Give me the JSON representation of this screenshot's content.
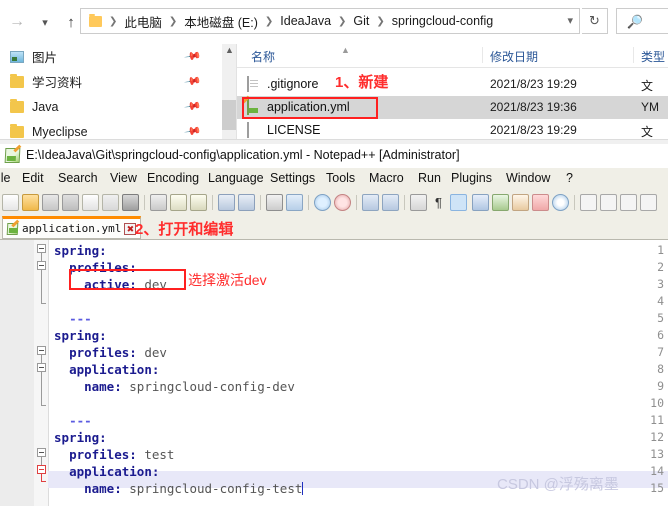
{
  "explorer": {
    "nav": {
      "forward_icon": "arrow-right-icon",
      "history_icon": "chevron-down-icon",
      "up_icon": "arrow-up-icon",
      "refresh_icon": "refresh-icon",
      "search_icon": "search-icon",
      "path_dropdown_icon": "chevron-down-icon"
    },
    "breadcrumbs": [
      "此电脑",
      "本地磁盘 (E:)",
      "IdeaJava",
      "Git",
      "springcloud-config"
    ],
    "quick_access": [
      {
        "label": "图片",
        "icon": "picture-icon",
        "pin": "pin-icon"
      },
      {
        "label": "学习资料",
        "icon": "folder-icon",
        "pin": "pin-icon"
      },
      {
        "label": "Java",
        "icon": "folder-icon",
        "pin": "pin-icon"
      },
      {
        "label": "Myeclipse",
        "icon": "folder-icon",
        "pin": "pin-icon"
      }
    ],
    "columns": {
      "name": "名称",
      "date": "修改日期",
      "type": "类型",
      "sort_icon": "sort-asc-icon"
    },
    "files": [
      {
        "name": ".gitignore",
        "date": "2021/8/23 19:29",
        "type": "文",
        "icon": "text-file-icon",
        "selected": false
      },
      {
        "name": "application.yml",
        "date": "2021/8/23 19:36",
        "type": "YM",
        "icon": "notepadpp-file-icon",
        "selected": true
      },
      {
        "name": "LICENSE",
        "date": "2021/8/23 19:29",
        "type": "文",
        "icon": "text-file-icon",
        "selected": false
      }
    ]
  },
  "annotations": {
    "step1": "1、新建",
    "step2": "2、打开和编辑",
    "step3": "选择激活dev"
  },
  "notepad": {
    "title": "E:\\IdeaJava\\Git\\springcloud-config\\application.yml - Notepad++ [Administrator]",
    "title_icon": "notepadpp-icon",
    "menus": [
      "ile",
      "Edit",
      "Search",
      "View",
      "Encoding",
      "Language",
      "Settings",
      "Tools",
      "Macro",
      "Run",
      "Plugins",
      "Window",
      "?"
    ],
    "toolbar_icons": [
      "new-icon",
      "open-icon",
      "save-icon",
      "save-all-icon",
      "close-icon",
      "close-all-icon",
      "print-icon",
      "cut-icon",
      "copy-icon",
      "paste-icon",
      "undo-icon",
      "redo-icon",
      "find-icon",
      "replace-icon",
      "zoom-in-icon",
      "zoom-out-icon",
      "sync-vertical-icon",
      "sync-horizontal-icon",
      "word-wrap-icon",
      "show-all-chars-icon",
      "indent-guide-icon",
      "ui-goto-icon",
      "show-doc-map-icon",
      "function-list-icon",
      "folder-as-workspace-icon",
      "monitoring-icon",
      "record-macro-icon",
      "stop-macro-icon",
      "play-macro-icon",
      "run-macro-multiple-icon"
    ],
    "tab": {
      "label": "application.yml",
      "icon": "yml-file-icon",
      "close_icon": "close-tab-icon"
    },
    "lines": [
      {
        "n": 1,
        "text": "spring:",
        "bold_end": 7
      },
      {
        "n": 2,
        "text": "  profiles:",
        "bold_end": 11
      },
      {
        "n": 3,
        "text": "    active: dev",
        "bold_end": 11
      },
      {
        "n": 4,
        "text": "",
        "bold_end": 0
      },
      {
        "n": 5,
        "text": "  ---",
        "bold_end": 0
      },
      {
        "n": 6,
        "text": "spring:",
        "bold_end": 7
      },
      {
        "n": 7,
        "text": "  profiles: dev",
        "bold_end": 11
      },
      {
        "n": 8,
        "text": "  application:",
        "bold_end": 14
      },
      {
        "n": 9,
        "text": "    name: springcloud-config-dev",
        "bold_end": 9
      },
      {
        "n": 10,
        "text": "",
        "bold_end": 0
      },
      {
        "n": 11,
        "text": "  ---",
        "bold_end": 0
      },
      {
        "n": 12,
        "text": "spring:",
        "bold_end": 7
      },
      {
        "n": 13,
        "text": "  profiles: test",
        "bold_end": 11
      },
      {
        "n": 14,
        "text": "  application:",
        "bold_end": 14
      },
      {
        "n": 15,
        "text": "    name: springcloud-config-test",
        "bold_end": 9
      }
    ],
    "current_line": 15
  },
  "watermark": "CSDN @浮殇离墨",
  "colors": {
    "annotation_red": "#ff2d2d",
    "tab_active_top": "#ff8c00",
    "code_key": "#1b1b8f",
    "code_value": "#555555",
    "selection_gray": "#d6d6d6",
    "current_line": "#e8e8f8",
    "column_header": "#2b5797"
  }
}
